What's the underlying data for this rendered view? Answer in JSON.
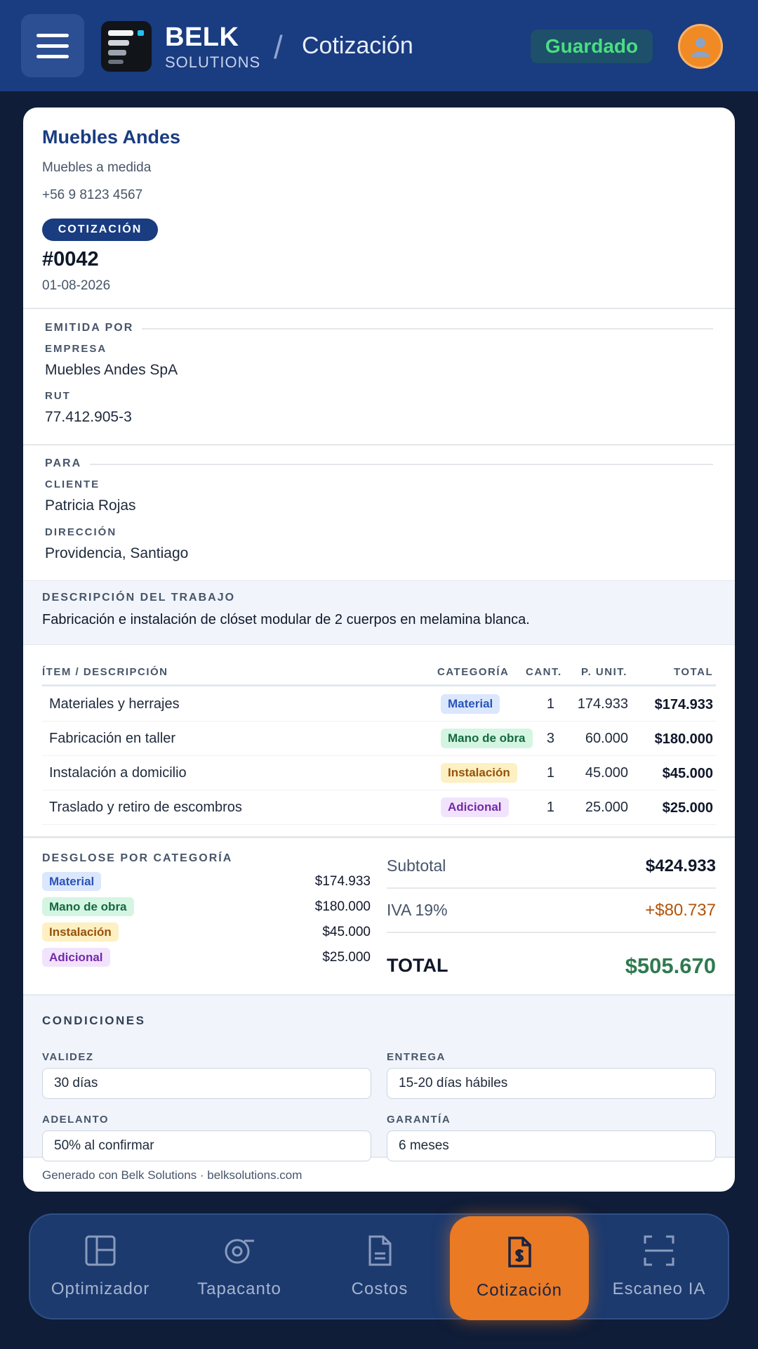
{
  "header": {
    "brand_name": "BELK",
    "brand_sub": "SOLUTIONS",
    "separator": "/",
    "page_title": "Cotización",
    "status": "Guardado"
  },
  "company": {
    "name": "Muebles Andes",
    "tagline": "Muebles a medida",
    "phone": "+56 9 8123 4567"
  },
  "quote": {
    "badge": "COTIZACIÓN",
    "number": "#0042",
    "date": "01-08-2026"
  },
  "issuer": {
    "section_label": "EMITIDA POR",
    "company_label": "EMPRESA",
    "company_value": "Muebles Andes SpA",
    "rut_label": "RUT",
    "rut_value": "77.412.905-3"
  },
  "recipient": {
    "section_label": "PARA",
    "client_label": "CLIENTE",
    "client_value": "Patricia Rojas",
    "address_label": "DIRECCIÓN",
    "address_value": "Providencia, Santiago"
  },
  "description": {
    "label": "DESCRIPCIÓN DEL TRABAJO",
    "text": "Fabricación e instalación de clóset modular de 2 cuerpos en melamina blanca."
  },
  "table": {
    "headers": [
      "ÍTEM / DESCRIPCIÓN",
      "CATEGORÍA",
      "CANT.",
      "P. UNIT.",
      "TOTAL"
    ],
    "rows": [
      {
        "desc": "Materiales y herrajes",
        "cat": "Material",
        "qty": "1",
        "unit": "174.933",
        "total": "$174.933"
      },
      {
        "desc": "Fabricación en taller",
        "cat": "Mano de obra",
        "qty": "3",
        "unit": "60.000",
        "total": "$180.000"
      },
      {
        "desc": "Instalación a domicilio",
        "cat": "Instalación",
        "qty": "1",
        "unit": "45.000",
        "total": "$45.000"
      },
      {
        "desc": "Traslado y retiro de escombros",
        "cat": "Adicional",
        "qty": "1",
        "unit": "25.000",
        "total": "$25.000"
      }
    ]
  },
  "breakdown": {
    "label": "DESGLOSE POR CATEGORÍA",
    "items": [
      {
        "cat": "Material",
        "amount": "$174.933"
      },
      {
        "cat": "Mano de obra",
        "amount": "$180.000"
      },
      {
        "cat": "Instalación",
        "amount": "$45.000"
      },
      {
        "cat": "Adicional",
        "amount": "$25.000"
      }
    ]
  },
  "totals": {
    "subtotal_label": "Subtotal",
    "subtotal_value": "$424.933",
    "iva_label": "IVA 19%",
    "iva_value": "+$80.737",
    "total_label": "TOTAL",
    "total_value": "$505.670"
  },
  "conditions": {
    "title": "CONDICIONES",
    "validity_label": "VALIDEZ",
    "validity_value": "30 días",
    "delivery_label": "ENTREGA",
    "delivery_value": "15-20 días hábiles",
    "advance_label": "ADELANTO",
    "advance_value": "50% al confirmar",
    "warranty_label": "GARANTÍA",
    "warranty_value": "6 meses"
  },
  "footer_note": "Generado con Belk Solutions · belksolutions.com",
  "nav": {
    "items": [
      {
        "label": "Optimizador",
        "icon": "layout-icon"
      },
      {
        "label": "Tapacanto",
        "icon": "edge-roll-icon"
      },
      {
        "label": "Costos",
        "icon": "document-icon"
      },
      {
        "label": "Cotización",
        "icon": "quote-document-icon",
        "active": true
      },
      {
        "label": "Escaneo IA",
        "icon": "scan-icon"
      }
    ]
  },
  "colors": {
    "header_bg": "#1a3c80",
    "page_bg": "#0f1d38",
    "accent_orange": "#ea7a23",
    "status_green": "#4ade80",
    "total_green": "#2f7a4f",
    "iva_orange": "#b45309"
  }
}
